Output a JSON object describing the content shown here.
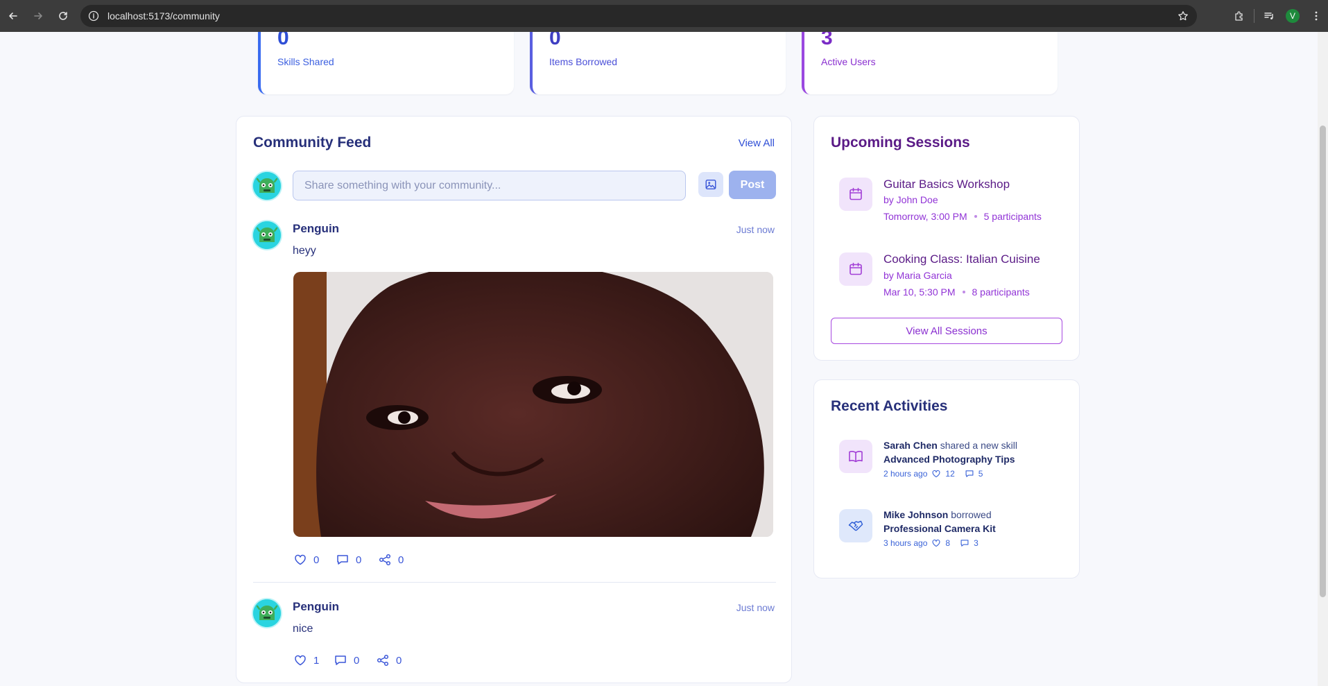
{
  "browser": {
    "url": "localhost:5173/community",
    "profile_initial": "V"
  },
  "stats": [
    {
      "value": "0",
      "label": "Skills Shared",
      "color": "#3b6cf0"
    },
    {
      "value": "0",
      "label": "Items Borrowed",
      "color": "#4a4fd8"
    },
    {
      "value": "3",
      "label": "Active Users",
      "color": "#8a2fd0"
    }
  ],
  "feed": {
    "title": "Community Feed",
    "view_all": "View All",
    "composer_placeholder": "Share something with your community...",
    "post_button": "Post",
    "posts": [
      {
        "author": "Penguin",
        "time": "Just now",
        "text": "heyy",
        "likes": "0",
        "comments": "0",
        "shares": "0"
      },
      {
        "author": "Penguin",
        "time": "Just now",
        "text": "nice",
        "likes": "1",
        "comments": "0",
        "shares": "0"
      }
    ]
  },
  "sessions": {
    "title": "Upcoming Sessions",
    "items": [
      {
        "title": "Guitar Basics Workshop",
        "by": "by John Doe",
        "when": "Tomorrow, 3:00 PM",
        "participants": "5 participants"
      },
      {
        "title": "Cooking Class: Italian Cuisine",
        "by": "by Maria Garcia",
        "when": "Mar 10, 5:30 PM",
        "participants": "8 participants"
      }
    ],
    "view_all": "View All Sessions"
  },
  "activities": {
    "title": "Recent Activities",
    "items": [
      {
        "user": "Sarah Chen",
        "verb": "shared a new skill",
        "object": "Advanced Photography Tips",
        "time": "2 hours ago",
        "likes": "12",
        "comments": "5",
        "icon": "book-icon"
      },
      {
        "user": "Mike Johnson",
        "verb": "borrowed",
        "object": "Professional Camera Kit",
        "time": "3 hours ago",
        "likes": "8",
        "comments": "3",
        "icon": "handshake-icon"
      }
    ]
  },
  "colors": {
    "primary": "#27307a",
    "accent_blue": "#3a56d8",
    "accent_purple": "#8a2fd0",
    "sessions_title": "#5a1a86",
    "activities_title": "#27307a"
  }
}
